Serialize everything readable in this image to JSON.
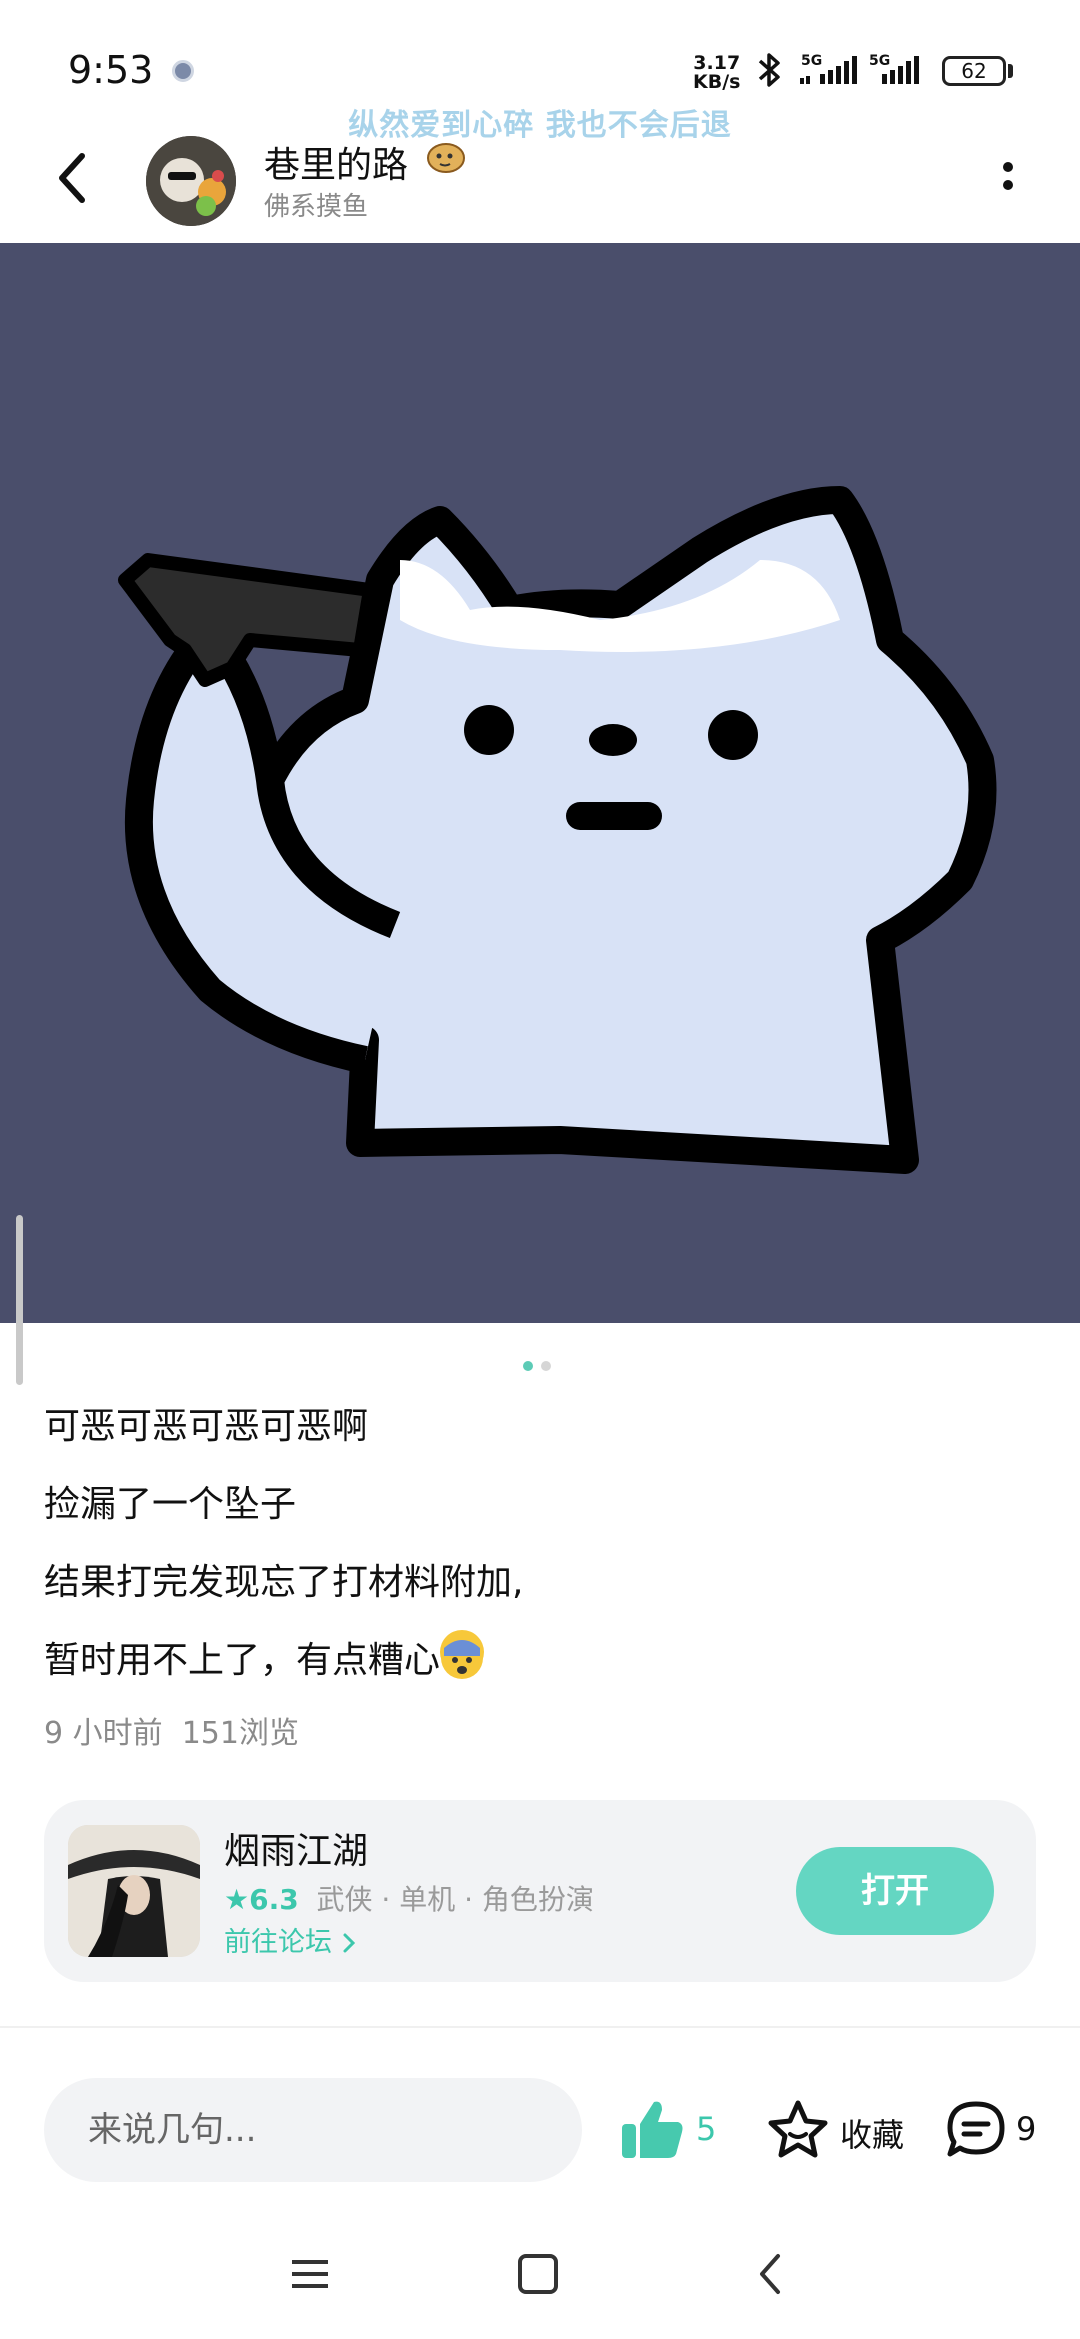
{
  "status_bar": {
    "time": "9:53",
    "net_speed_value": "3.17",
    "net_speed_unit": "KB/s",
    "signal1_label": "5G",
    "signal2_label": "5G",
    "battery": "62"
  },
  "lyric": "纵然爱到心碎  我也不会后退",
  "header": {
    "user_name": "巷里的路",
    "user_subtitle": "佛系摸鱼"
  },
  "post": {
    "image_page_indicator": {
      "current": 1,
      "total": 2
    },
    "lines": [
      "可恶可恶可恶可恶啊",
      "捡漏了一个坠子",
      "结果打完发现忘了打材料附加,",
      "暂时用不上了，有点糟心"
    ],
    "time_ago": "9 小时前",
    "views": "151浏览"
  },
  "game_card": {
    "title": "烟雨江湖",
    "rating": "6.3",
    "tags": "武侠 · 单机 · 角色扮演",
    "forum_link": "前往论坛",
    "open_button": "打开"
  },
  "bottom_bar": {
    "comment_placeholder": "来说几句...",
    "like_count": "5",
    "favorite_label": "收藏",
    "comment_count": "9"
  },
  "colors": {
    "accent": "#3cc7ac",
    "button": "#64d6c2",
    "image_background": "#4a4e6b",
    "card_background": "#f2f3f5"
  },
  "icons": [
    "back-icon",
    "more-icon",
    "like-icon",
    "favorite-icon",
    "comment-icon",
    "bluetooth-icon",
    "signal-icon",
    "battery-icon",
    "nav-menu-icon",
    "nav-home-icon",
    "nav-back-icon"
  ]
}
